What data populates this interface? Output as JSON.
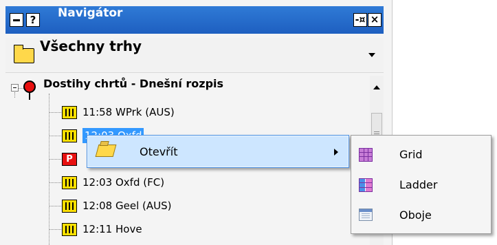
{
  "window": {
    "title": "Navigátor",
    "help_label": "?",
    "pin_label": "-¤",
    "close_label": "×"
  },
  "selector": {
    "label": "Všechny trhy"
  },
  "tree": {
    "root_label": "Dostihy chrtů - Dnešní rozpis",
    "items": [
      {
        "label": "11:58 WPrk (AUS)",
        "icon": "race-icon"
      },
      {
        "label": "12:03 Oxfd",
        "icon": "race-icon",
        "selected": true
      },
      {
        "label": "",
        "icon": "park-icon",
        "icon_text": "P"
      },
      {
        "label": "12:03 Oxfd (FC)",
        "icon": "race-icon"
      },
      {
        "label": "12:08 Geel (AUS)",
        "icon": "race-icon"
      },
      {
        "label": "12:11 Hove",
        "icon": "race-icon"
      }
    ]
  },
  "context_menu": {
    "item_label": "Otevřít"
  },
  "submenu": {
    "items": [
      {
        "label": "Grid",
        "icon": "grid-icon"
      },
      {
        "label": "Ladder",
        "icon": "ladder-icon"
      },
      {
        "label": "Oboje",
        "icon": "both-icon"
      }
    ]
  },
  "colors": {
    "titlebar": "#2f7ad6",
    "selection": "#3399ff",
    "menu_highlight": "#cde6ff"
  }
}
